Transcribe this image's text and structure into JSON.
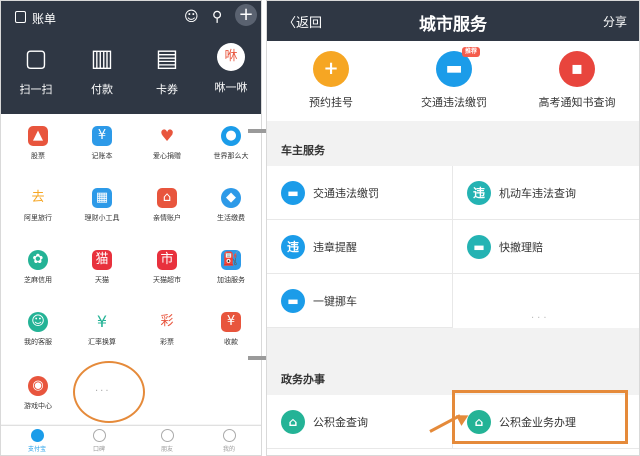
{
  "left": {
    "header": {
      "title": "账单",
      "icons": [
        "contacts-icon",
        "search-icon",
        "plus-icon"
      ]
    },
    "quick": [
      {
        "label": "扫一扫",
        "icon": "scan-icon"
      },
      {
        "label": "付款",
        "icon": "barcode-icon"
      },
      {
        "label": "卡券",
        "icon": "card-icon"
      },
      {
        "label": "咻一咻",
        "icon": "xiu-icon"
      }
    ],
    "grid": [
      {
        "label": "股票",
        "color": "#e8553d",
        "glyph": "▲"
      },
      {
        "label": "记账本",
        "color": "#2d9ae8",
        "glyph": "¥"
      },
      {
        "label": "爱心捐赠",
        "color": "#e8553d",
        "glyph": "♥"
      },
      {
        "label": "世界那么大",
        "color": "#1b9ce9",
        "glyph": "●"
      },
      {
        "label": "阿里旅行",
        "color": "#f6a623",
        "glyph": "去"
      },
      {
        "label": "理财小工具",
        "color": "#2d9ae8",
        "glyph": "▦"
      },
      {
        "label": "亲情账户",
        "color": "#e8553d",
        "glyph": "⌂"
      },
      {
        "label": "生活缴费",
        "color": "#2d9ae8",
        "glyph": "◆"
      },
      {
        "label": "芝麻信用",
        "color": "#24b396",
        "glyph": "✿"
      },
      {
        "label": "天猫",
        "color": "#e8313d",
        "glyph": "猫"
      },
      {
        "label": "天猫超市",
        "color": "#e8313d",
        "glyph": "市"
      },
      {
        "label": "加油服务",
        "color": "#2d9ae8",
        "glyph": "⛽"
      },
      {
        "label": "我的客服",
        "color": "#24b396",
        "glyph": "☺"
      },
      {
        "label": "汇率换算",
        "color": "#24b396",
        "glyph": "¥"
      },
      {
        "label": "彩票",
        "color": "#e8553d",
        "glyph": "彩"
      },
      {
        "label": "收款",
        "color": "#e8553d",
        "glyph": "¥"
      },
      {
        "label": "游戏中心",
        "color": "#e8553d",
        "glyph": "◉"
      }
    ],
    "tabs": [
      {
        "label": "支付宝",
        "active": true
      },
      {
        "label": "口碑",
        "active": false
      },
      {
        "label": "朋友",
        "active": false
      },
      {
        "label": "我的",
        "active": false
      }
    ]
  },
  "right": {
    "nav": {
      "back": "返回",
      "title": "城市服务",
      "share": "分享"
    },
    "top": [
      {
        "label": "预约挂号",
        "color": "#f6a623",
        "glyph": "+"
      },
      {
        "label": "交通违法缴罚",
        "color": "#1b9ce9",
        "glyph": "▬",
        "badge": "推荐"
      },
      {
        "label": "高考通知书查询",
        "color": "#e8453d",
        "glyph": "▪"
      }
    ],
    "section1": "车主服务",
    "car_items": [
      {
        "label": "交通违法缴罚",
        "color": "#1b9ce9",
        "glyph": "▬"
      },
      {
        "label": "机动车违法查询",
        "color": "#24b3b3",
        "glyph": "违"
      },
      {
        "label": "违章提醒",
        "color": "#1b9ce9",
        "glyph": "违"
      },
      {
        "label": "快撤理赔",
        "color": "#24b3b3",
        "glyph": "▬"
      },
      {
        "label": "一键挪车",
        "color": "#1b9ce9",
        "glyph": "▬"
      }
    ],
    "section2": "政务办事",
    "gov_items": [
      {
        "label": "公积金查询",
        "color": "#24b396",
        "glyph": "⌂"
      },
      {
        "label": "公积金业务办理",
        "color": "#24b396",
        "glyph": "⌂"
      }
    ]
  },
  "colors": {
    "dark_header": "#2f3744",
    "annotation": "#e58a3a",
    "accent": "#1b9ce9"
  }
}
